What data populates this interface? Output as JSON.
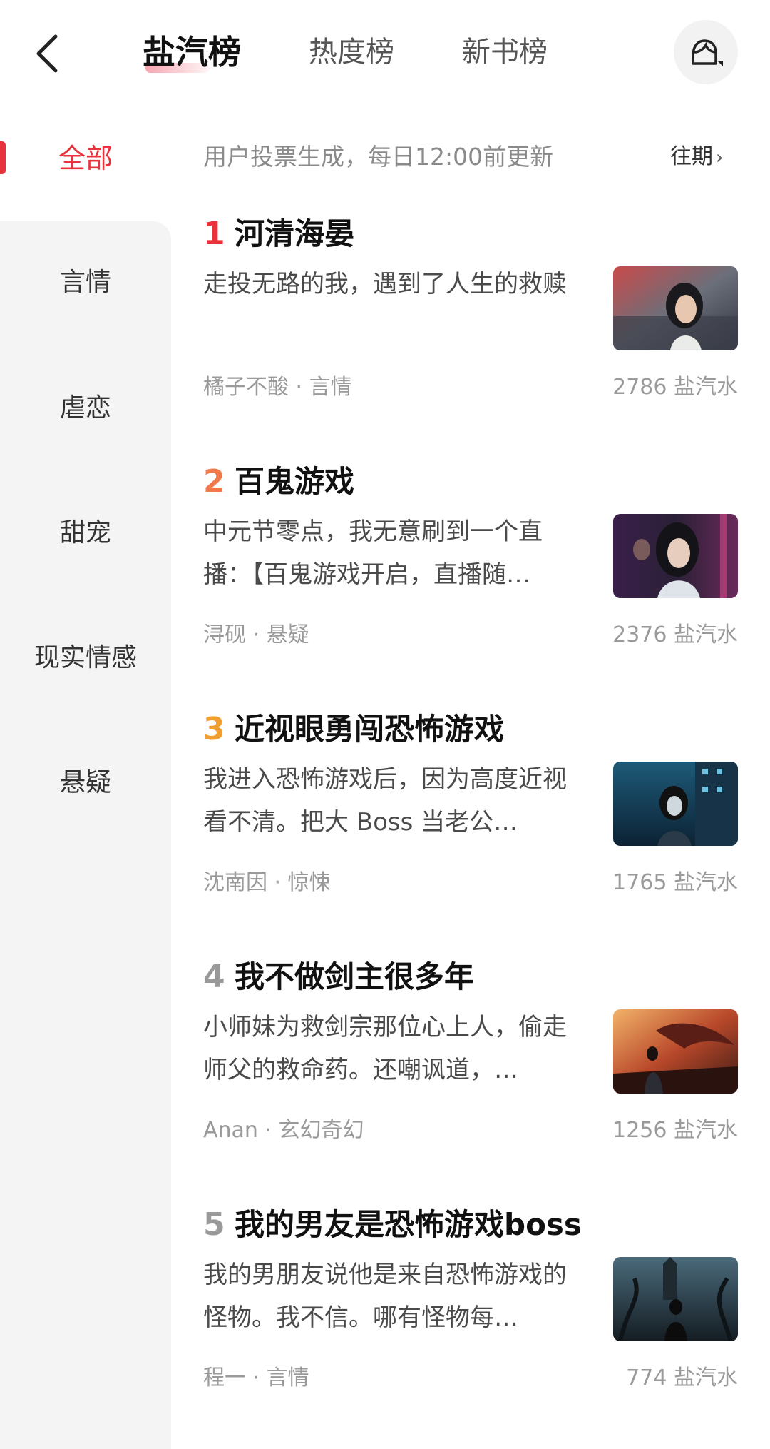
{
  "header": {
    "tabs": [
      {
        "label": "盐汽榜",
        "active": true
      },
      {
        "label": "热度榜",
        "active": false
      },
      {
        "label": "新书榜",
        "active": false
      }
    ],
    "back_icon": "chevron-left-icon",
    "avatar_icon": "user-avatar-icon"
  },
  "sidebar": {
    "items": [
      {
        "label": "全部",
        "active": true
      },
      {
        "label": "言情"
      },
      {
        "label": "虐恋"
      },
      {
        "label": "甜宠"
      },
      {
        "label": "现实情感"
      },
      {
        "label": "悬疑"
      }
    ]
  },
  "notice": {
    "text": "用户投票生成，每日12:00前更新",
    "history_label": "往期",
    "history_chevron": "›"
  },
  "ranking": [
    {
      "rank": "1",
      "title": "河清海晏",
      "desc": "走投无路的我，遇到了人生的救赎",
      "meta": "橘子不酸 · 言情",
      "score": "2786 盐汽水"
    },
    {
      "rank": "2",
      "title": "百鬼游戏",
      "desc": "中元节零点，我无意刷到一个直播：【百鬼游戏开启，直播随…",
      "meta": "浔砚 · 悬疑",
      "score": "2376 盐汽水"
    },
    {
      "rank": "3",
      "title": "近视眼勇闯恐怖游戏",
      "desc": "我进入恐怖游戏后，因为高度近视看不清。把大 Boss 当老公…",
      "meta": "沈南因 · 惊悚",
      "score": "1765 盐汽水"
    },
    {
      "rank": "4",
      "title": "我不做剑主很多年",
      "desc": "小师妹为救剑宗那位心上人，偷走师父的救命药。还嘲讽道，…",
      "meta": "Anan · 玄幻奇幻",
      "score": "1256 盐汽水"
    },
    {
      "rank": "5",
      "title": "我的男友是恐怖游戏boss",
      "desc": "我的男朋友说他是来自恐怖游戏的怪物。我不信。哪有怪物每…",
      "meta": "程一 · 言情",
      "score": "774 盐汽水"
    }
  ],
  "colors": {
    "accent": "#e8333c",
    "rank2": "#f07a4a",
    "rank3": "#f0a030",
    "muted": "#9a9a9a"
  }
}
